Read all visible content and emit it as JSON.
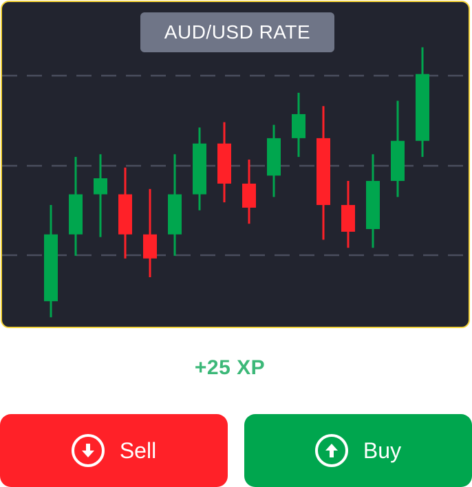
{
  "chart": {
    "title": "AUD/USD RATE",
    "colors": {
      "up": "#00a64e",
      "down": "#ff2128",
      "background": "#22242f",
      "grid": "#4a4e5e",
      "border": "#f3d33a"
    }
  },
  "chart_data": {
    "type": "candlestick",
    "title": "AUD/USD RATE",
    "grid": "dashed horizontal lines",
    "ylim": [
      0,
      100
    ],
    "candles": [
      {
        "direction": "up",
        "open": 8,
        "close": 33,
        "high": 44,
        "low": 2
      },
      {
        "direction": "up",
        "open": 33,
        "close": 48,
        "high": 62,
        "low": 25
      },
      {
        "direction": "up",
        "open": 48,
        "close": 54,
        "high": 63,
        "low": 32
      },
      {
        "direction": "down",
        "open": 48,
        "close": 33,
        "high": 58,
        "low": 24
      },
      {
        "direction": "down",
        "open": 33,
        "close": 24,
        "high": 50,
        "low": 17
      },
      {
        "direction": "up",
        "open": 33,
        "close": 48,
        "high": 63,
        "low": 25
      },
      {
        "direction": "up",
        "open": 48,
        "close": 67,
        "high": 73,
        "low": 42
      },
      {
        "direction": "down",
        "open": 67,
        "close": 52,
        "high": 75,
        "low": 45
      },
      {
        "direction": "down",
        "open": 52,
        "close": 43,
        "high": 61,
        "low": 37
      },
      {
        "direction": "up",
        "open": 55,
        "close": 69,
        "high": 74,
        "low": 47
      },
      {
        "direction": "up",
        "open": 69,
        "close": 78,
        "high": 86,
        "low": 62
      },
      {
        "direction": "down",
        "open": 69,
        "close": 44,
        "high": 81,
        "low": 31
      },
      {
        "direction": "down",
        "open": 44,
        "close": 34,
        "high": 53,
        "low": 28
      },
      {
        "direction": "up",
        "open": 35,
        "close": 53,
        "high": 63,
        "low": 28
      },
      {
        "direction": "up",
        "open": 53,
        "close": 68,
        "high": 83,
        "low": 47
      },
      {
        "direction": "up",
        "open": 68,
        "close": 93,
        "high": 103,
        "low": 62
      }
    ]
  },
  "reward": {
    "label": "+25 XP",
    "color": "#3cb878"
  },
  "actions": {
    "sell": {
      "label": "Sell",
      "icon": "arrow-down-circle-icon",
      "color": "#ff2128"
    },
    "buy": {
      "label": "Buy",
      "icon": "arrow-up-circle-icon",
      "color": "#00a64e"
    }
  }
}
